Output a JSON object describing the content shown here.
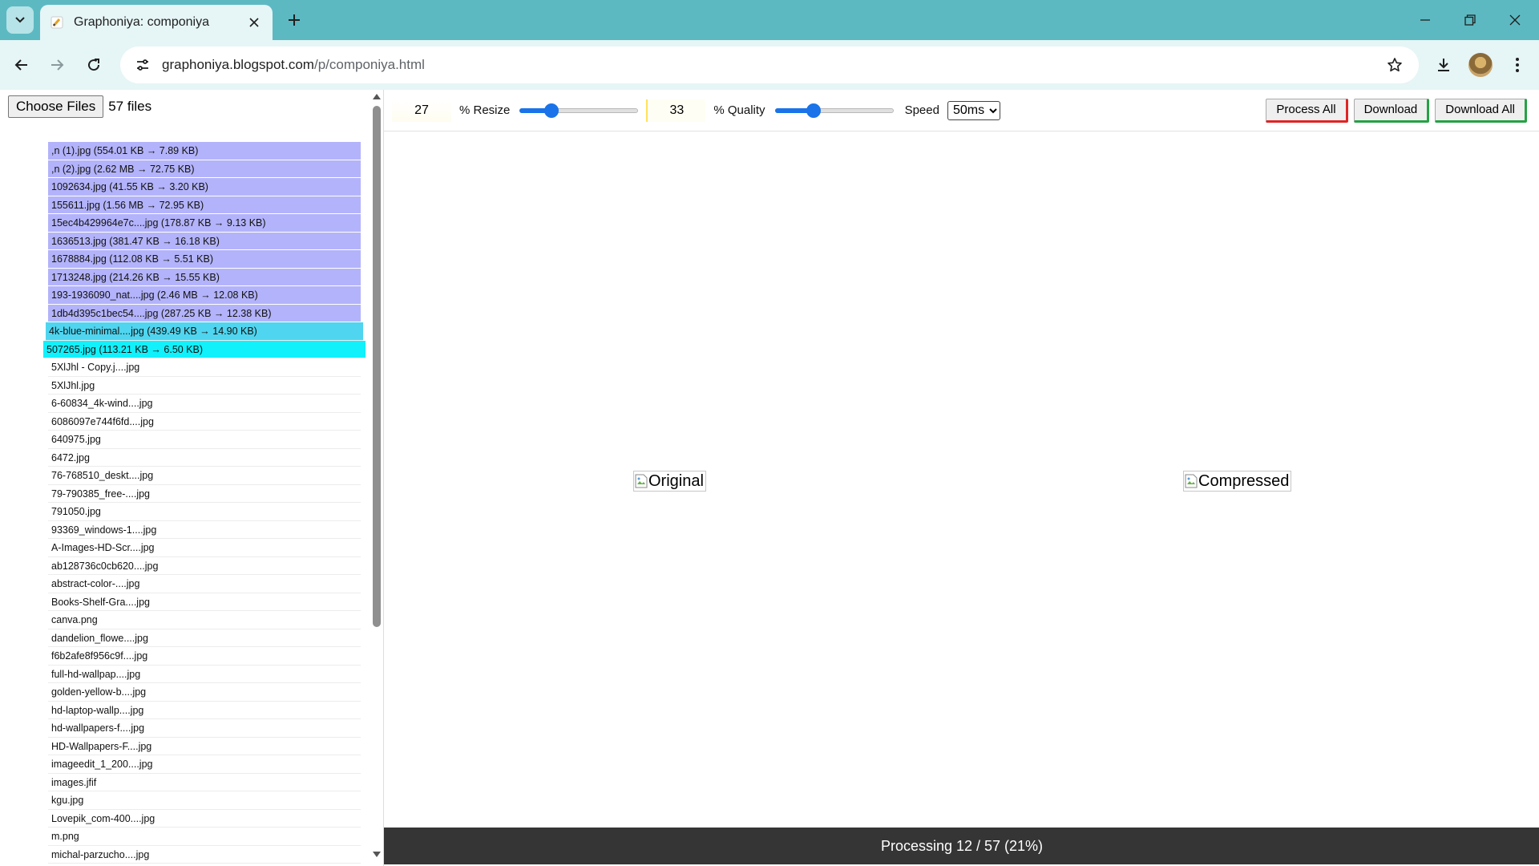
{
  "browser": {
    "tab_title": "Graphoniya: componiya",
    "url_host": "graphoniya.blogspot.com",
    "url_path": "/p/componiya.html"
  },
  "file_picker": {
    "button_label": "Choose Files",
    "file_count": "57 files"
  },
  "files": [
    {
      "label": ",n (1).jpg (554.01 KB → 7.89 KB)",
      "state": "done"
    },
    {
      "label": ",n (2).jpg (2.62 MB → 72.75 KB)",
      "state": "done"
    },
    {
      "label": "1092634.jpg (41.55 KB → 3.20 KB)",
      "state": "done"
    },
    {
      "label": "155611.jpg (1.56 MB → 72.95 KB)",
      "state": "done"
    },
    {
      "label": "15ec4b429964e7c....jpg (178.87 KB → 9.13 KB)",
      "state": "done"
    },
    {
      "label": "1636513.jpg (381.47 KB → 16.18 KB)",
      "state": "done"
    },
    {
      "label": "1678884.jpg (112.08 KB → 5.51 KB)",
      "state": "done"
    },
    {
      "label": "1713248.jpg (214.26 KB → 15.55 KB)",
      "state": "done"
    },
    {
      "label": "193-1936090_nat....jpg (2.46 MB → 12.08 KB)",
      "state": "done"
    },
    {
      "label": "1db4d395c1bec54....jpg (287.25 KB → 12.38 KB)",
      "state": "done"
    },
    {
      "label": "4k-blue-minimal....jpg (439.49 KB → 14.90 KB)",
      "state": "processing"
    },
    {
      "label": "507265.jpg (113.21 KB → 6.50 KB)",
      "state": "current"
    },
    {
      "label": "5XlJhl - Copy.j....jpg",
      "state": "pending"
    },
    {
      "label": "5XlJhl.jpg",
      "state": "pending"
    },
    {
      "label": "6-60834_4k-wind....jpg",
      "state": "pending"
    },
    {
      "label": "6086097e744f6fd....jpg",
      "state": "pending"
    },
    {
      "label": "640975.jpg",
      "state": "pending"
    },
    {
      "label": "6472.jpg",
      "state": "pending"
    },
    {
      "label": "76-768510_deskt....jpg",
      "state": "pending"
    },
    {
      "label": "79-790385_free-....jpg",
      "state": "pending"
    },
    {
      "label": "791050.jpg",
      "state": "pending"
    },
    {
      "label": "93369_windows-1....jpg",
      "state": "pending"
    },
    {
      "label": "A-Images-HD-Scr....jpg",
      "state": "pending"
    },
    {
      "label": "ab128736c0cb620....jpg",
      "state": "pending"
    },
    {
      "label": "abstract-color-....jpg",
      "state": "pending"
    },
    {
      "label": "Books-Shelf-Gra....jpg",
      "state": "pending"
    },
    {
      "label": "canva.png",
      "state": "pending"
    },
    {
      "label": "dandelion_flowe....jpg",
      "state": "pending"
    },
    {
      "label": "f6b2afe8f956c9f....jpg",
      "state": "pending"
    },
    {
      "label": "full-hd-wallpap....jpg",
      "state": "pending"
    },
    {
      "label": "golden-yellow-b....jpg",
      "state": "pending"
    },
    {
      "label": "hd-laptop-wallp....jpg",
      "state": "pending"
    },
    {
      "label": "hd-wallpapers-f....jpg",
      "state": "pending"
    },
    {
      "label": "HD-Wallpapers-F....jpg",
      "state": "pending"
    },
    {
      "label": "imageedit_1_200....jpg",
      "state": "pending"
    },
    {
      "label": "images.jfif",
      "state": "pending"
    },
    {
      "label": "kgu.jpg",
      "state": "pending"
    },
    {
      "label": "Lovepik_com-400....jpg",
      "state": "pending"
    },
    {
      "label": "m.png",
      "state": "pending"
    },
    {
      "label": "michal-parzucho....jpg",
      "state": "pending"
    }
  ],
  "controls": {
    "resize_value": "27",
    "resize_label": "% Resize",
    "resize_slider_fraction": 0.27,
    "quality_value": "33",
    "quality_label": "% Quality",
    "quality_slider_fraction": 0.33,
    "speed_label": "Speed",
    "speed_selected": "50ms",
    "process_all_label": "Process All",
    "download_label": "Download",
    "download_all_label": "Download All"
  },
  "preview": {
    "original_alt": "Original",
    "compressed_alt": "Compressed"
  },
  "status": {
    "text": "Processing 12 / 57 (21%)"
  },
  "colors": {
    "tabstrip": "#5cb9c2",
    "done_row": "#b3b3fb",
    "processing_row": "#4fd5ef",
    "current_row": "#11f1fb",
    "slider_accent": "#1a73e8",
    "status_bar": "#353535"
  },
  "icons": [
    "tab-search-icon",
    "favicon-icon",
    "close-icon",
    "plus-icon",
    "minimize-icon",
    "restore-icon",
    "close-window-icon",
    "back-icon",
    "forward-icon",
    "reload-icon",
    "site-settings-icon",
    "star-icon",
    "download-icon"
  ]
}
